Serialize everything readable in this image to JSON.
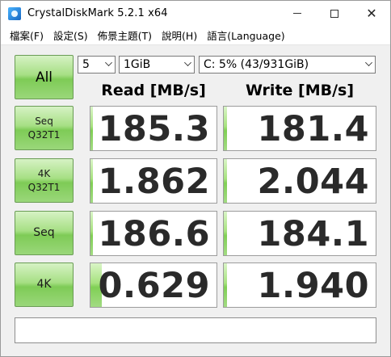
{
  "window": {
    "title": "CrystalDiskMark 5.2.1 x64"
  },
  "menu": [
    {
      "label": "檔案(F)"
    },
    {
      "label": "設定(S)"
    },
    {
      "label": "佈景主題(T)"
    },
    {
      "label": "說明(H)"
    },
    {
      "label": "語言(Language)"
    }
  ],
  "controls": {
    "all_label": "All",
    "test_count": "5",
    "test_size": "1GiB",
    "drive": "C: 5% (43/931GiB)"
  },
  "headers": {
    "read": "Read [MB/s]",
    "write": "Write [MB/s]"
  },
  "tests": [
    {
      "line1": "Seq",
      "line2": "Q32T1",
      "read": "185.3",
      "write": "181.4",
      "read_fill": 0.02,
      "write_fill": 0.02
    },
    {
      "line1": "4K",
      "line2": "Q32T1",
      "read": "1.862",
      "write": "2.044",
      "read_fill": 0.02,
      "write_fill": 0.02
    },
    {
      "line1": "Seq",
      "line2": "",
      "read": "186.6",
      "write": "184.1",
      "read_fill": 0.02,
      "write_fill": 0.02
    },
    {
      "line1": "4K",
      "line2": "",
      "read": "0.629",
      "write": "1.940",
      "read_fill": 0.09,
      "write_fill": 0.02
    }
  ],
  "comment": ""
}
